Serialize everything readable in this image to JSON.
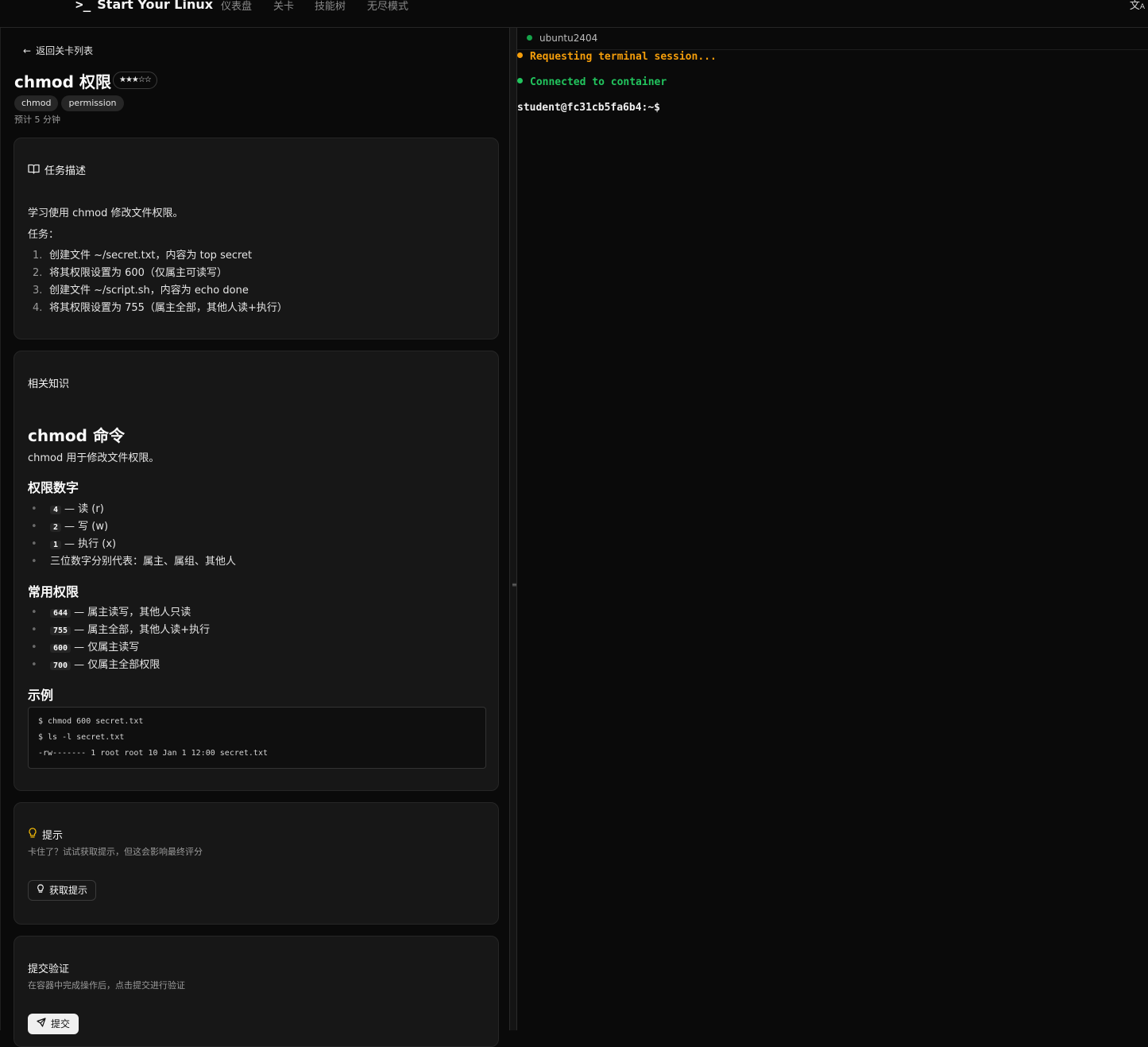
{
  "header": {
    "brand_prompt": ">_",
    "brand": "Start Your Linux",
    "nav": [
      "仪表盘",
      "关卡",
      "技能树",
      "无尽模式"
    ],
    "language_icon": "translate-icon"
  },
  "level": {
    "back_label": "返回关卡列表",
    "title": "chmod 权限",
    "difficulty_stars": "★★★☆☆",
    "difficulty_rating": 3,
    "tags": [
      "chmod",
      "permission"
    ],
    "estimate": "预计 5 分钟"
  },
  "task": {
    "title": "任务描述",
    "intro": "学习使用 chmod 修改文件权限。",
    "label": "任务：",
    "steps": [
      {
        "num": "1.",
        "text": "创建文件 ~/secret.txt，内容为 top secret"
      },
      {
        "num": "2.",
        "text": "将其权限设置为 600（仅属主可读写）"
      },
      {
        "num": "3.",
        "text": "创建文件 ~/script.sh，内容为 echo done"
      },
      {
        "num": "4.",
        "text": "将其权限设置为 755（属主全部，其他人读+执行）"
      }
    ]
  },
  "knowledge": {
    "title": "相关知识",
    "heading": "chmod 命令",
    "desc": "chmod 用于修改文件权限。",
    "perm_heading": "权限数字",
    "perm_items": [
      {
        "code": "4",
        "text": "— 读 (r)"
      },
      {
        "code": "2",
        "text": "— 写 (w)"
      },
      {
        "code": "1",
        "text": "— 执行 (x)"
      },
      {
        "code": "",
        "text": "三位数字分别代表：属主、属组、其他人"
      }
    ],
    "common_heading": "常用权限",
    "common_items": [
      {
        "code": "644",
        "text": "— 属主读写，其他人只读"
      },
      {
        "code": "755",
        "text": "— 属主全部，其他人读+执行"
      },
      {
        "code": "600",
        "text": "— 仅属主读写"
      },
      {
        "code": "700",
        "text": "— 仅属主全部权限"
      }
    ],
    "example_heading": "示例",
    "example_lines": [
      " $ chmod 600 secret.txt",
      "$ ls -l secret.txt",
      "-rw------- 1 root root 10 Jan 1 12:00 secret.txt"
    ]
  },
  "hint": {
    "title": "提示",
    "desc": "卡住了？试试获取提示，但这会影响最终评分",
    "button": "获取提示"
  },
  "submit": {
    "title": "提交验证",
    "desc": "在容器中完成操作后，点击提交进行验证",
    "button": "提交"
  },
  "terminal": {
    "host": "ubuntu2404",
    "lines": [
      {
        "text": "Requesting terminal session...",
        "color": "#f59e0b"
      },
      {
        "text": "Connected to container",
        "color": "#22c55e"
      }
    ],
    "prompt": "student@fc31cb5fa6b4:~$"
  }
}
